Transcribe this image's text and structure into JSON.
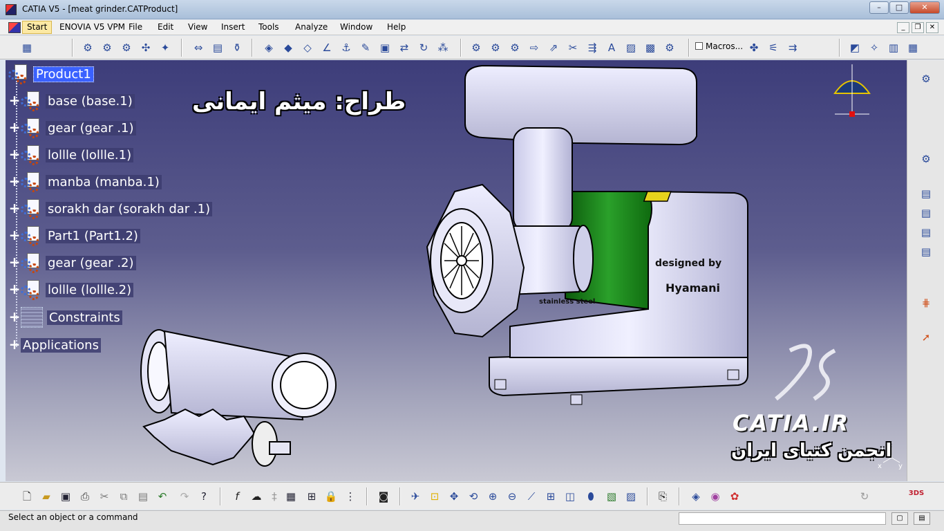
{
  "window": {
    "title": "CATIA V5 - [meat grinder.CATProduct]"
  },
  "menu": {
    "items": [
      "Start",
      "ENOVIA V5 VPM",
      "File",
      "Edit",
      "View",
      "Insert",
      "Tools",
      "Analyze",
      "Window",
      "Help"
    ]
  },
  "toolbar": {
    "macros_label": "Macros..."
  },
  "tree": {
    "root": "Product1",
    "items": [
      "base (base.1)",
      "gear  (gear .1)",
      "lollle (lollle.1)",
      "manba (manba.1)",
      "sorakh dar  (sorakh dar .1)",
      "Part1 (Part1.2)",
      "gear  (gear .2)",
      "lollle (lollle.2)",
      "Constraints",
      "Applications"
    ]
  },
  "viewport": {
    "designer_text": "طراح: میثم ایمانی",
    "model_text_1": "designed by",
    "model_text_2": "Hyamani",
    "model_text_3": "stainless steel",
    "watermark_site": "CATIA.IR",
    "watermark_forum": "انجمن کتیای ایران",
    "axis_z": "z",
    "axis_x": "x",
    "axis_y": "y"
  },
  "status": {
    "message": "Select an object or a command"
  },
  "colors": {
    "viewport_top": "#3d3d7a",
    "viewport_bottom": "#c9c9d4",
    "selection": "#3a61ff",
    "motor_green": "#1e7c1e"
  }
}
